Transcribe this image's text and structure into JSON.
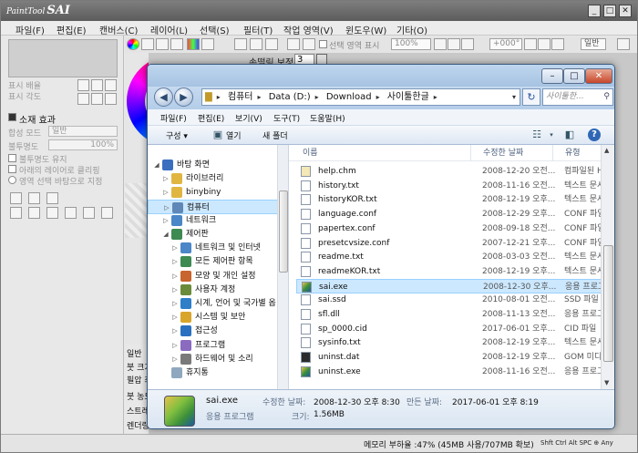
{
  "sai": {
    "logo_small": "PaintTool",
    "logo_big": "SAI",
    "menu": [
      "파일(F)",
      "편집(E)",
      "캔버스(C)",
      "레이어(L)",
      "선택(S)",
      "필터(T)",
      "작업 영역(V)",
      "윈도우(W)",
      "기타(O)"
    ],
    "toolbar": {
      "select_show_label": "선택 영역 표시",
      "zoom": "100%",
      "angle": "+000°",
      "mode": "일반"
    },
    "left": {
      "zoom_label": "표시 배율",
      "rotate_label": "표시 각도",
      "effects_title": "소재 효과",
      "blend_label": "합성 모드",
      "blend_value": "일반",
      "opacity_label": "불투명도",
      "opacity_value": "100%",
      "preserve_opacity": "불투명도 유지",
      "clip_lower": "아래의 레이어로 클리핑",
      "selection_source": "영역 선택 바탕으로 지정"
    },
    "stabilizer_label": "손떨림 보정",
    "stabilizer_value": "3",
    "lower_left": [
      "일반",
      "붓 크기",
      "필압 최",
      "붓 농도",
      "스트레",
      "렌더링"
    ],
    "status": "메모리 부하율 :47% (45MB 사용/707MB 확보)",
    "status_keys": "Shft Ctrl Alt SPC ⊕ Any"
  },
  "explorer": {
    "breadcrumb": [
      "컴퓨터",
      "Data (D:)",
      "Download",
      "사이툴한글"
    ],
    "search_placeholder": "사이툴한...",
    "menu": [
      "파일(F)",
      "편집(E)",
      "보기(V)",
      "도구(T)",
      "도움말(H)"
    ],
    "commands": {
      "organize": "구성 ▾",
      "open": "열기",
      "new_folder": "새 폴더"
    },
    "tree": [
      {
        "label": "바탕 화면",
        "indent": 0,
        "color": "#3a6fc0",
        "arrow": "◢"
      },
      {
        "label": "라이브러리",
        "indent": 1,
        "color": "#e0b640",
        "arrow": "▷"
      },
      {
        "label": "binybiny",
        "indent": 1,
        "color": "#e0b640",
        "arrow": "▷"
      },
      {
        "label": "컴퓨터",
        "indent": 1,
        "color": "#5f88b8",
        "arrow": "▷",
        "selected": true
      },
      {
        "label": "네트워크",
        "indent": 1,
        "color": "#4a86c8",
        "arrow": "▷"
      },
      {
        "label": "제어판",
        "indent": 1,
        "color": "#3d8a52",
        "arrow": "◢"
      },
      {
        "label": "네트워크 및 인터넷",
        "indent": 2,
        "color": "#4a86c8",
        "arrow": "▷"
      },
      {
        "label": "모든 제어판 항목",
        "indent": 2,
        "color": "#3d8a52",
        "arrow": "▷"
      },
      {
        "label": "모양 및 개인 설정",
        "indent": 2,
        "color": "#c8642e",
        "arrow": "▷"
      },
      {
        "label": "사용자 계정",
        "indent": 2,
        "color": "#6a8c3a",
        "arrow": "▷"
      },
      {
        "label": "시계, 언어 및 국가별 옵",
        "indent": 2,
        "color": "#2e7ec8",
        "arrow": "▷"
      },
      {
        "label": "시스템 및 보안",
        "indent": 2,
        "color": "#d9a52b",
        "arrow": "▷"
      },
      {
        "label": "접근성",
        "indent": 2,
        "color": "#2b70c0",
        "arrow": "▷"
      },
      {
        "label": "프로그램",
        "indent": 2,
        "color": "#8a6bc0",
        "arrow": "▷"
      },
      {
        "label": "하드웨어 및 소리",
        "indent": 2,
        "color": "#7a7a7a",
        "arrow": "▷"
      },
      {
        "label": "휴지통",
        "indent": 1,
        "color": "#8fa8c0",
        "arrow": ""
      }
    ],
    "columns": {
      "name": "이름",
      "date": "수정한 날짜",
      "type": "유형"
    },
    "files": [
      {
        "name": "help.chm",
        "date": "2008-12-20 오전...",
        "type": "컴파일된 HT"
      },
      {
        "name": "history.txt",
        "date": "2008-11-16 오전...",
        "type": "텍스트 문서"
      },
      {
        "name": "historyKOR.txt",
        "date": "2008-12-19 오후...",
        "type": "텍스트 문서"
      },
      {
        "name": "language.conf",
        "date": "2008-12-29 오후...",
        "type": "CONF 파일"
      },
      {
        "name": "papertex.conf",
        "date": "2008-09-18 오전...",
        "type": "CONF 파일"
      },
      {
        "name": "presetcvsize.conf",
        "date": "2007-12-21 오후...",
        "type": "CONF 파일"
      },
      {
        "name": "readme.txt",
        "date": "2008-03-03 오전...",
        "type": "텍스트 문서"
      },
      {
        "name": "readmeKOR.txt",
        "date": "2008-12-19 오후...",
        "type": "텍스트 문서"
      },
      {
        "name": "sai.exe",
        "date": "2008-12-30 오후...",
        "type": "응용 프로그램",
        "selected": true
      },
      {
        "name": "sai.ssd",
        "date": "2010-08-01 오전...",
        "type": "SSD 파일"
      },
      {
        "name": "sfl.dll",
        "date": "2008-11-13 오전...",
        "type": "응용 프로그"
      },
      {
        "name": "sp_0000.cid",
        "date": "2017-06-01 오후...",
        "type": "CID 파일"
      },
      {
        "name": "sysinfo.txt",
        "date": "2008-12-19 오후...",
        "type": "텍스트 문서"
      },
      {
        "name": "uninst.dat",
        "date": "2008-12-19 오후...",
        "type": "GOM 미디어"
      },
      {
        "name": "uninst.exe",
        "date": "2008-11-16 오전...",
        "type": "응용 프로그"
      }
    ],
    "details": {
      "filename": "sai.exe",
      "kind": "응용 프로그램",
      "modified_label": "수정한 날짜:",
      "modified_value": "2008-12-30 오후 8:30",
      "created_label": "만든 날짜:",
      "created_value": "2017-06-01 오후 8:19",
      "size_label": "크기:",
      "size_value": "1.56MB"
    }
  }
}
